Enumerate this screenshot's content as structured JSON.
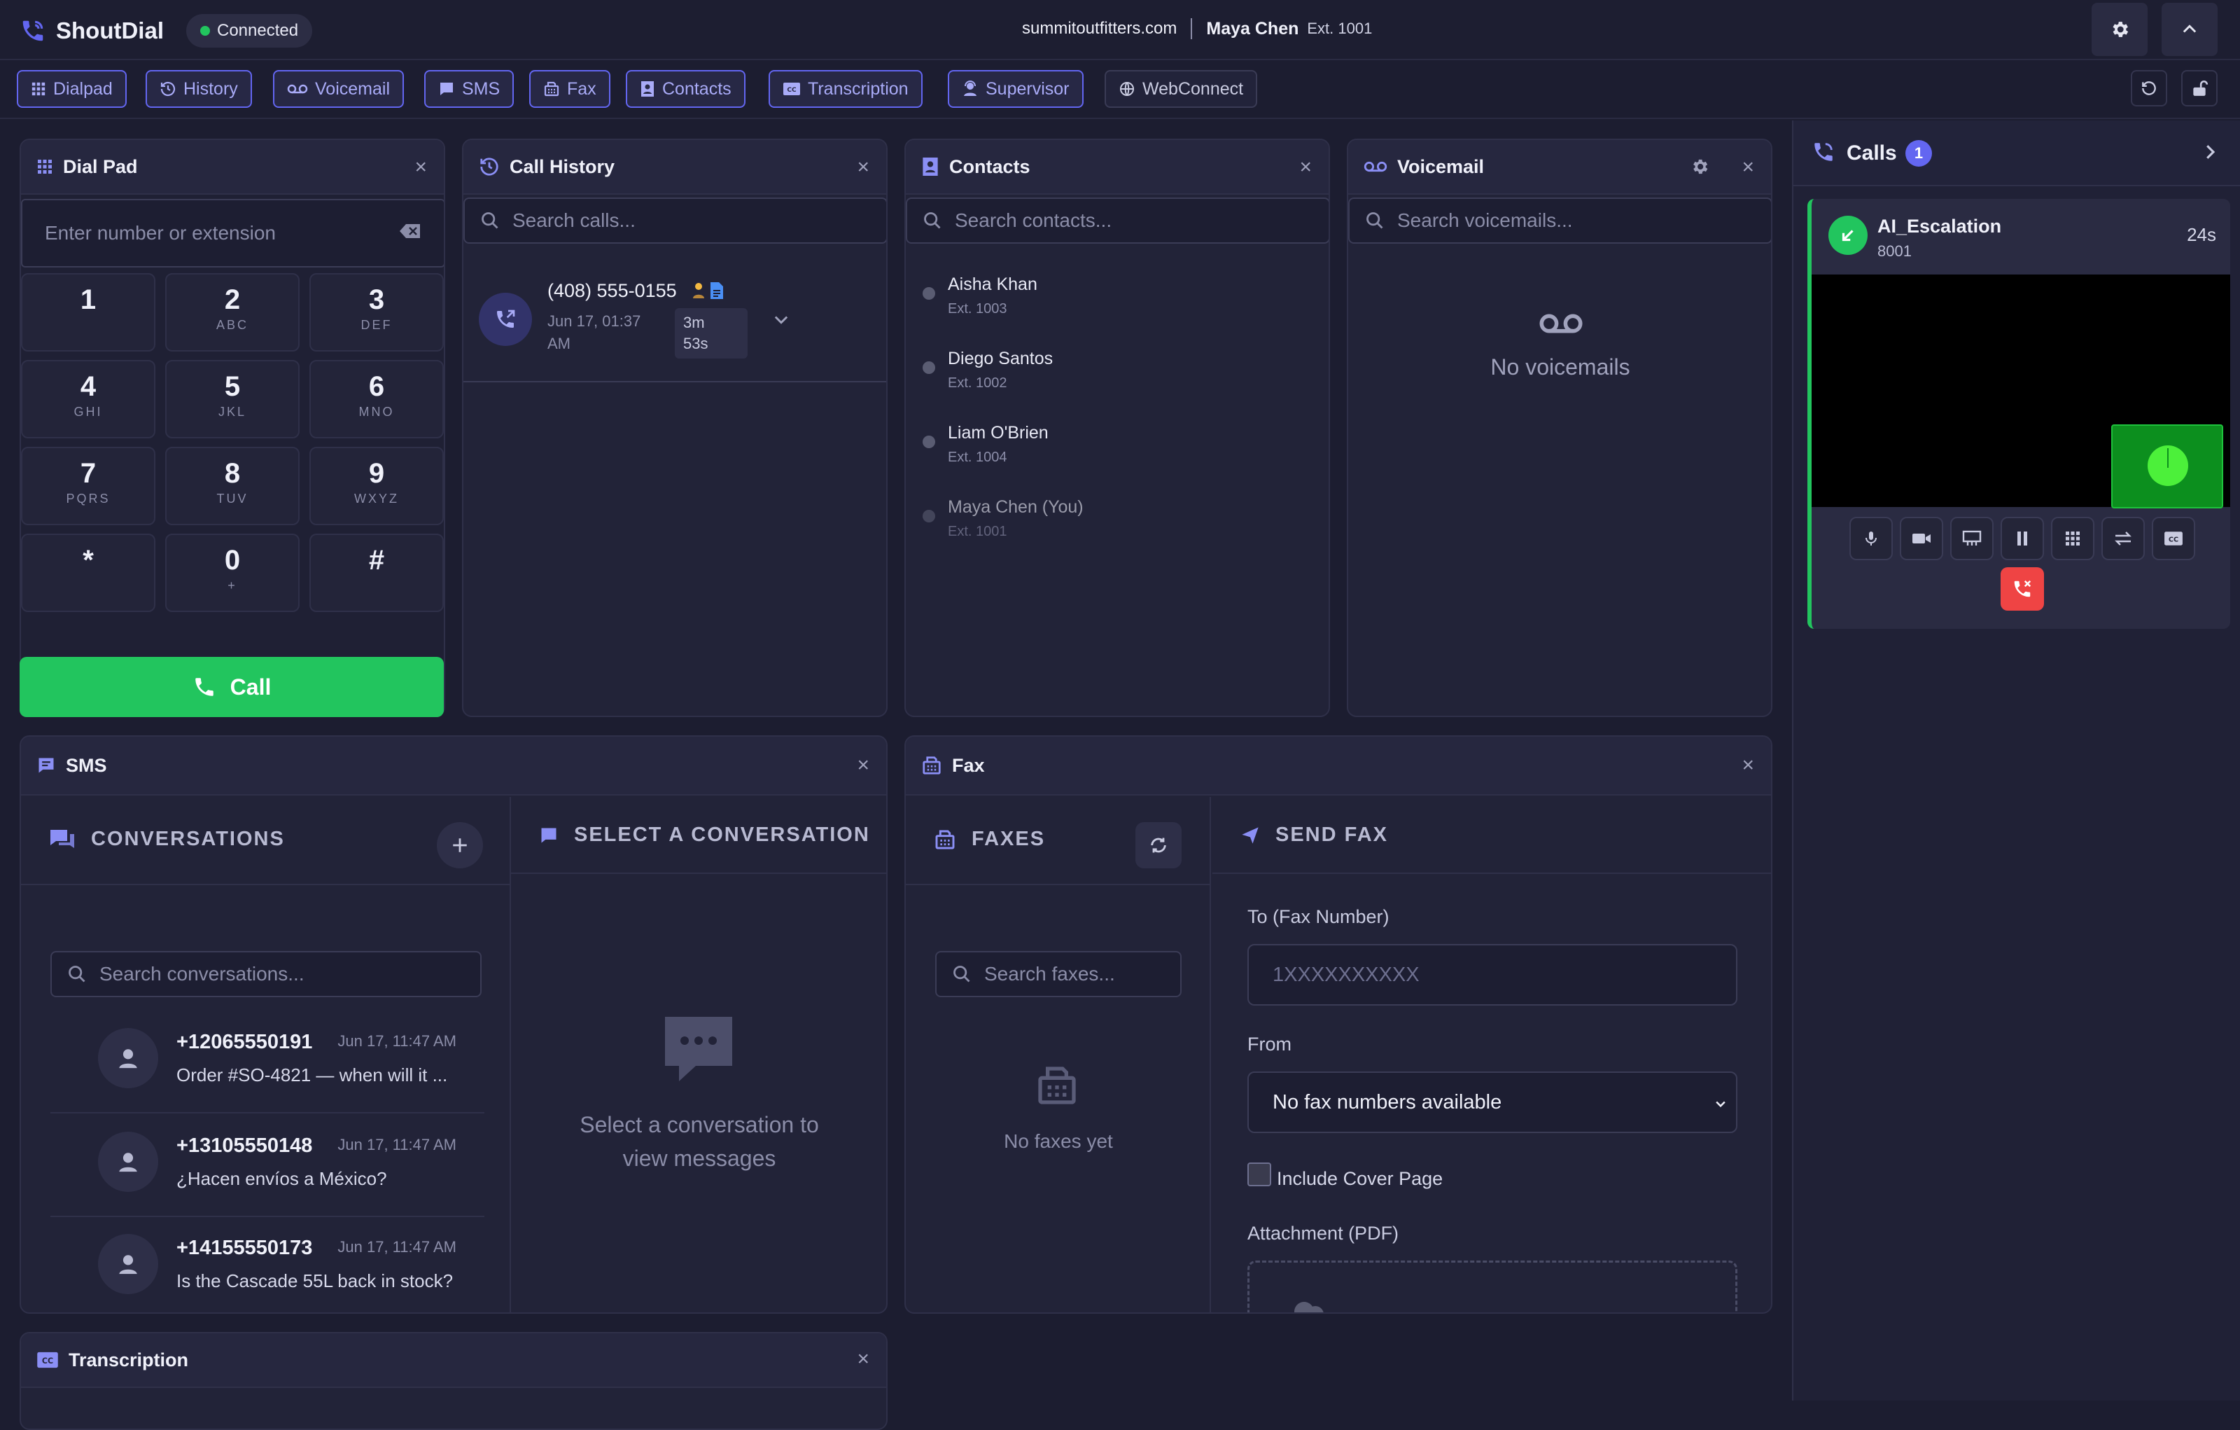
{
  "app": {
    "name": "ShoutDial",
    "status": "Connected",
    "domain": "summitoutfitters.com",
    "user": "Maya Chen",
    "ext": "Ext. 1001"
  },
  "tabs": [
    "Dialpad",
    "History",
    "Voicemail",
    "SMS",
    "Fax",
    "Contacts",
    "Transcription",
    "Supervisor",
    "WebConnect"
  ],
  "dialpad": {
    "title": "Dial Pad",
    "placeholder": "Enter number or extension",
    "keys": [
      {
        "n": "1",
        "l": ""
      },
      {
        "n": "2",
        "l": "ABC"
      },
      {
        "n": "3",
        "l": "DEF"
      },
      {
        "n": "4",
        "l": "GHI"
      },
      {
        "n": "5",
        "l": "JKL"
      },
      {
        "n": "6",
        "l": "MNO"
      },
      {
        "n": "7",
        "l": "PQRS"
      },
      {
        "n": "8",
        "l": "TUV"
      },
      {
        "n": "9",
        "l": "WXYZ"
      },
      {
        "n": "*",
        "l": ""
      },
      {
        "n": "0",
        "l": "+"
      },
      {
        "n": "#",
        "l": ""
      }
    ],
    "call_label": "Call"
  },
  "history": {
    "title": "Call History",
    "placeholder": "Search calls...",
    "entry": {
      "number": "(408) 555-0155",
      "date_line1": "Jun 17, 01:37",
      "date_line2": "AM",
      "dur_line1": "3m",
      "dur_line2": "53s"
    }
  },
  "contacts": {
    "title": "Contacts",
    "placeholder": "Search contacts...",
    "items": [
      {
        "name": "Aisha Khan",
        "ext": "Ext. 1003"
      },
      {
        "name": "Diego Santos",
        "ext": "Ext. 1002"
      },
      {
        "name": "Liam O'Brien",
        "ext": "Ext. 1004"
      },
      {
        "name": "Maya Chen (You)",
        "ext": "Ext. 1001"
      }
    ]
  },
  "voicemail": {
    "title": "Voicemail",
    "placeholder": "Search voicemails...",
    "empty": "No voicemails"
  },
  "calls": {
    "title": "Calls",
    "count": "1",
    "active": {
      "name": "AI_Escalation",
      "number": "8001",
      "duration": "24s"
    }
  },
  "sms": {
    "title": "SMS",
    "conversations_title": "CONVERSATIONS",
    "select_title": "SELECT A CONVERSATION",
    "placeholder": "Search conversations...",
    "empty_line1": "Select a conversation to",
    "empty_line2": "view messages",
    "items": [
      {
        "number": "+12065550191",
        "time": "Jun 17, 11:47 AM",
        "message": "Order #SO-4821 — when will it ..."
      },
      {
        "number": "+13105550148",
        "time": "Jun 17, 11:47 AM",
        "message": "¿Hacen envíos a México?"
      },
      {
        "number": "+14155550173",
        "time": "Jun 17, 11:47 AM",
        "message": "Is the Cascade 55L back in stock?"
      }
    ]
  },
  "fax": {
    "title": "Fax",
    "faxes_title": "FAXES",
    "send_title": "SEND FAX",
    "placeholder": "Search faxes...",
    "empty": "No faxes yet",
    "to_label": "To (Fax Number)",
    "to_placeholder": "1XXXXXXXXXX",
    "from_label": "From",
    "from_value": "No fax numbers available",
    "cover_label": "Include Cover Page",
    "attach_label": "Attachment (PDF)"
  },
  "transcription": {
    "title": "Transcription"
  },
  "colors": {
    "accent": "#6366f1",
    "success": "#22c55e",
    "danger": "#ef4444",
    "background": "#1c1d30",
    "panel": "#222338"
  }
}
